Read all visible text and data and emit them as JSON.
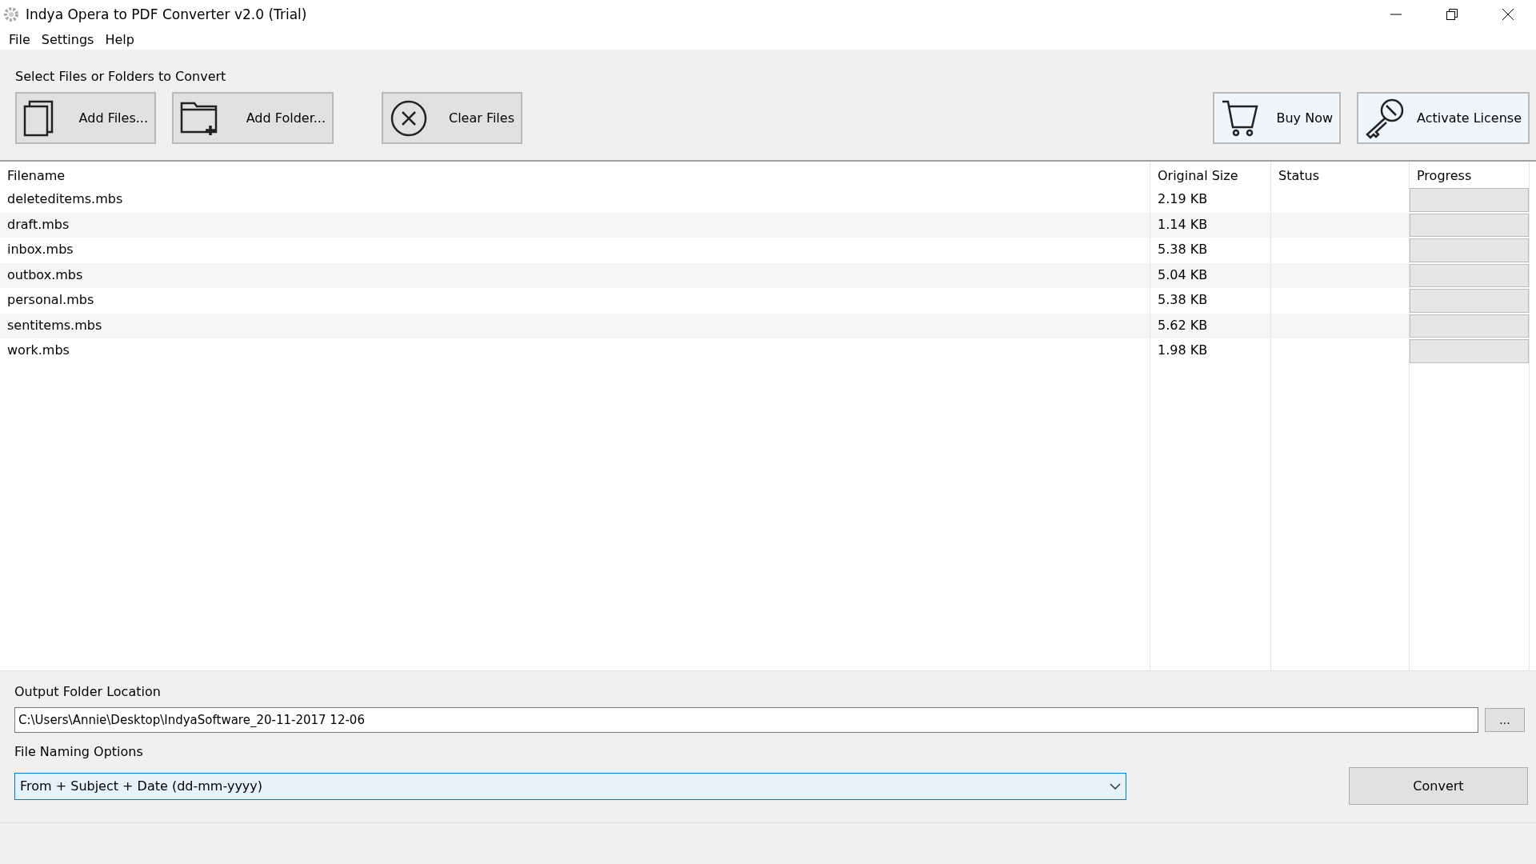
{
  "window": {
    "title": "Indya Opera to PDF Converter v2.0 (Trial)"
  },
  "menu": [
    "File",
    "Settings",
    "Help"
  ],
  "select_label": "Select Files or Folders to Convert",
  "toolbar_left": [
    {
      "kind": "files",
      "label": "Add Files..."
    },
    {
      "kind": "folder",
      "label": "Add Folder..."
    },
    {
      "kind": "clear",
      "label": "Clear Files"
    }
  ],
  "toolbar_right": [
    {
      "kind": "cart",
      "label": "Buy Now"
    },
    {
      "kind": "key",
      "label": "Activate License"
    }
  ],
  "table": {
    "columns": [
      "Filename",
      "Original Size",
      "Status",
      "Progress"
    ],
    "rows": [
      {
        "filename": "deleteditems.mbs",
        "size": "2.19 KB",
        "level": 0
      },
      {
        "filename": "draft.mbs",
        "size": "1.14 KB",
        "level": 0
      },
      {
        "filename": "inbox.mbs",
        "size": "5.38 KB",
        "level": 0
      },
      {
        "filename": "outbox.mbs",
        "size": "5.04 KB",
        "level": 0
      },
      {
        "filename": "personal.mbs",
        "size": "5.38 KB",
        "level": 0
      },
      {
        "filename": "sentitems.mbs",
        "size": "5.62 KB",
        "level": 0
      },
      {
        "filename": "work.mbs",
        "size": "1.98 KB",
        "level": 0
      }
    ]
  },
  "output": {
    "label": "Output Folder Location",
    "value": "C:\\Users\\Annie\\Desktop\\IndyaSoftware_20-11-2017 12-06",
    "browse": "..."
  },
  "naming": {
    "label": "File Naming Options",
    "value": "From + Subject + Date (dd-mm-yyyy)"
  },
  "convert": "Convert"
}
